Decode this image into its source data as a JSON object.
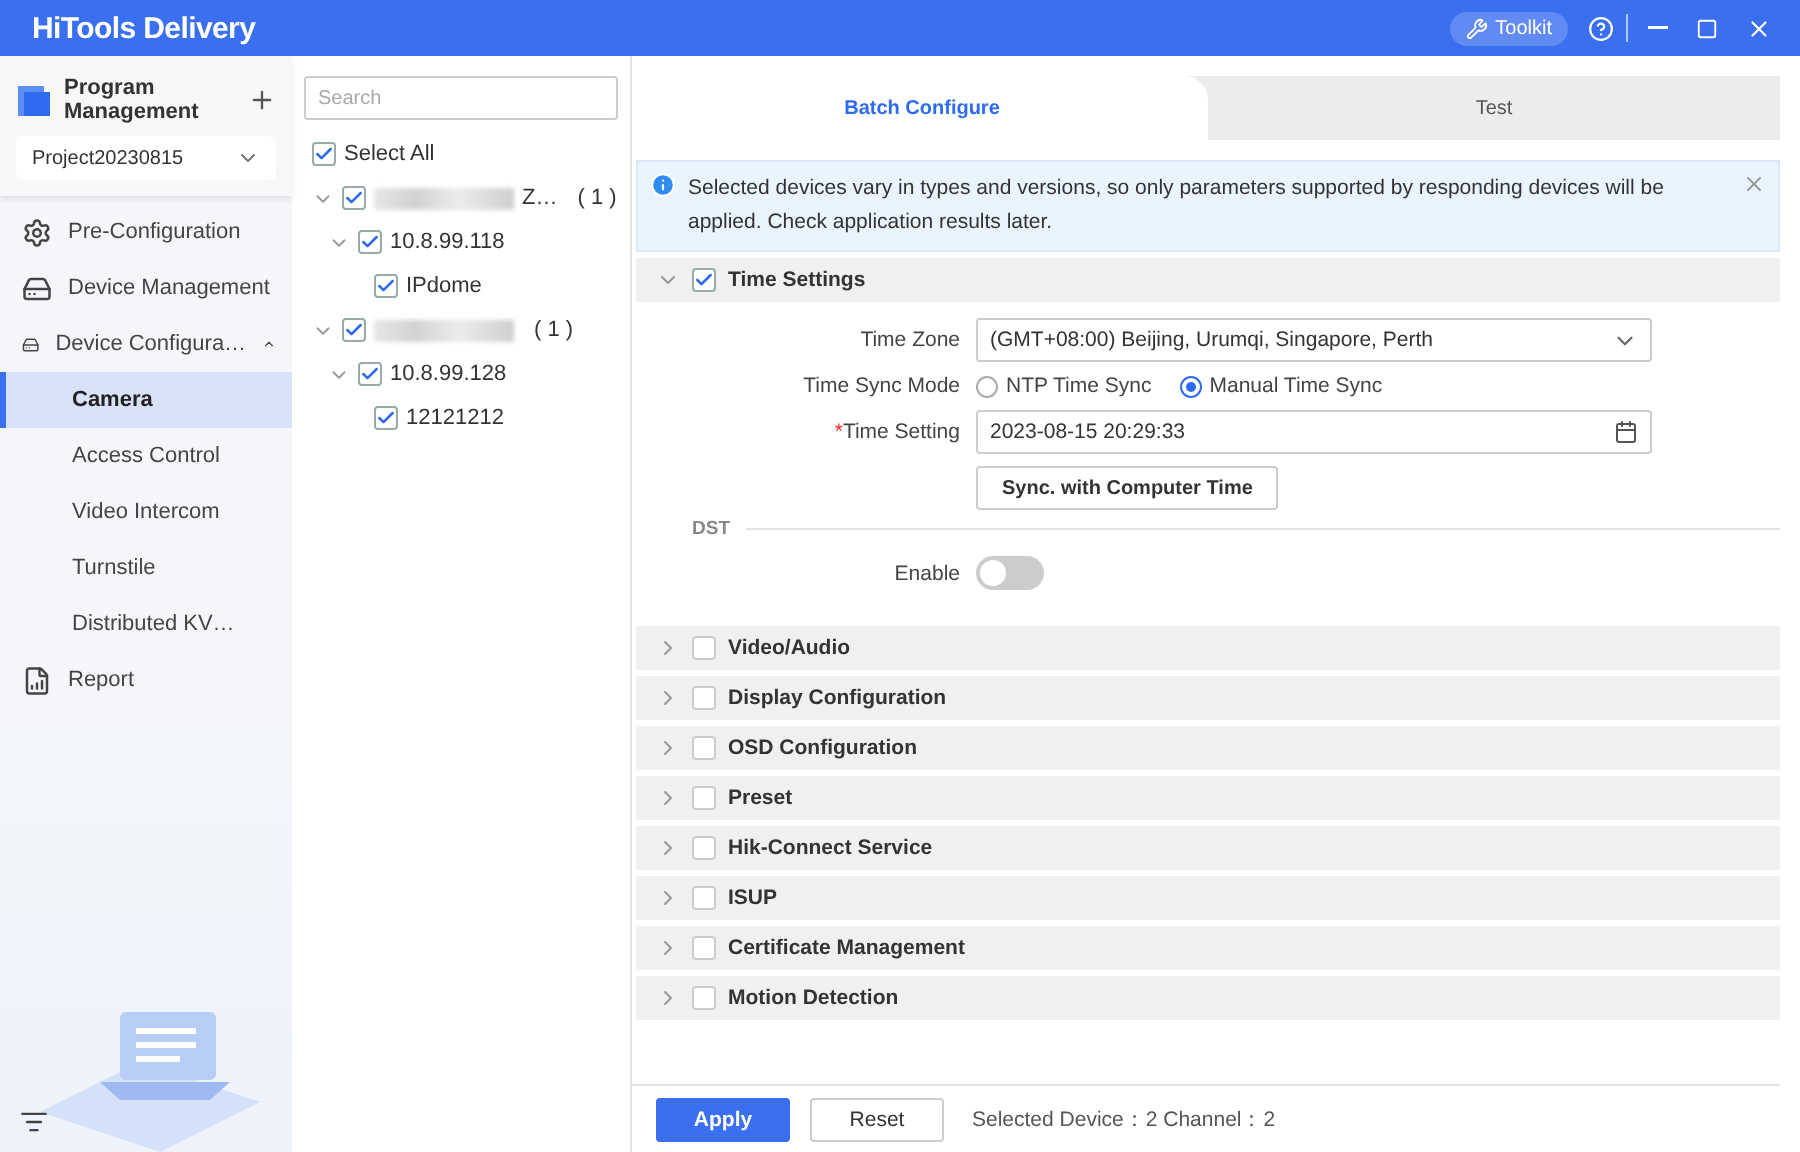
{
  "titlebar": {
    "logo": "HiTools Delivery",
    "toolkit": "Toolkit"
  },
  "sidebar": {
    "title": "Program Management",
    "project": "Project20230815",
    "items": [
      {
        "label": "Pre-Configuration",
        "selected": false
      },
      {
        "label": "Device Management",
        "selected": false
      },
      {
        "label": "Device Configura…",
        "selected": false,
        "expanded": true,
        "children": [
          {
            "label": "Camera",
            "selected": true
          },
          {
            "label": "Access Control",
            "selected": false
          },
          {
            "label": "Video Intercom",
            "selected": false
          },
          {
            "label": "Turnstile",
            "selected": false
          },
          {
            "label": "Distributed KV…",
            "selected": false
          }
        ]
      },
      {
        "label": "Report",
        "selected": false
      }
    ]
  },
  "tree": {
    "search_placeholder": "Search",
    "select_all": {
      "label": "Select All",
      "checked": true
    },
    "nodes": [
      {
        "label": "Z…",
        "redacted": true,
        "count": "( 1 )",
        "checked": true,
        "expanded": true,
        "children": [
          {
            "label": "10.8.99.118",
            "checked": true,
            "expanded": true,
            "children": [
              {
                "label": "IPdome",
                "checked": true
              }
            ]
          }
        ]
      },
      {
        "redacted": true,
        "count": "( 1 )",
        "checked": true,
        "expanded": true,
        "children": [
          {
            "label": "10.8.99.128",
            "checked": true,
            "expanded": true,
            "children": [
              {
                "label": "12121212",
                "checked": true
              }
            ]
          }
        ]
      }
    ]
  },
  "tabs": [
    {
      "label": "Batch Configure",
      "selected": true
    },
    {
      "label": "Test",
      "selected": false
    }
  ],
  "notice": "Selected devices vary in types and versions, so only parameters supported by responding devices will be applied. Check application results later.",
  "time_settings": {
    "title": "Time Settings",
    "checked": true,
    "expanded": true,
    "time_zone": {
      "label": "Time Zone",
      "value": "(GMT+08:00) Beijing, Urumqi, Singapore, Perth"
    },
    "sync_mode": {
      "label": "Time Sync Mode",
      "options": [
        {
          "label": "NTP Time Sync",
          "selected": false
        },
        {
          "label": "Manual Time Sync",
          "selected": true
        }
      ]
    },
    "time_setting": {
      "label": "Time Setting",
      "required_mark": "*",
      "value": "2023-08-15 20:29:33"
    },
    "sync_button": "Sync. with Computer Time",
    "dst": {
      "heading": "DST",
      "label": "Enable",
      "on": false
    }
  },
  "sections": [
    {
      "title": "Video/Audio",
      "checked": false
    },
    {
      "title": "Display Configuration",
      "checked": false
    },
    {
      "title": "OSD Configuration",
      "checked": false
    },
    {
      "title": "Preset",
      "checked": false
    },
    {
      "title": "Hik-Connect Service",
      "checked": false
    },
    {
      "title": "ISUP",
      "checked": false
    },
    {
      "title": "Certificate Management",
      "checked": false
    },
    {
      "title": "Motion Detection",
      "checked": false
    }
  ],
  "footer": {
    "apply": "Apply",
    "reset": "Reset",
    "status": "Selected Device：2 Channel：2"
  }
}
